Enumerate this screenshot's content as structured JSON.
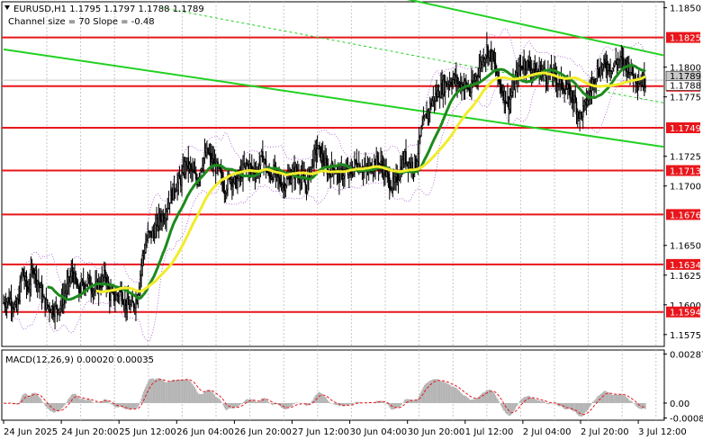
{
  "chart_data": {
    "type": "candlestick",
    "symbol_header": "EURUSD,H1  1.1795 1.1797 1.1788 1.1789",
    "channel_info": "Channel size = 70 Slope = -0.48",
    "price_axis": {
      "min": 1.1565,
      "max": 1.1855,
      "ticks": [
        "1.1850",
        "1.1800",
        "1.1775",
        "1.1725",
        "1.1700",
        "1.1650",
        "1.1625",
        "1.1600",
        "1.1575"
      ],
      "tick_values": [
        1.185,
        1.18,
        1.1775,
        1.1725,
        1.17,
        1.165,
        1.1625,
        1.16,
        1.1575
      ]
    },
    "time_axis_labels": [
      "24 Jun 2025",
      "24 Jun 20:00",
      "25 Jun 12:00",
      "26 Jun 04:00",
      "26 Jun 20:00",
      "27 Jun 12:00",
      "30 Jun 04:00",
      "30 Jun 20:00",
      "1 Jul 12:00",
      "2 Jul 04:00",
      "2 Jul 20:00",
      "3 Jul 12:00"
    ],
    "levels": [
      {
        "label": "1.1825",
        "value": 1.1825
      },
      {
        "label": "1.1784",
        "value": 1.1784
      },
      {
        "label": "1.1749",
        "value": 1.1749
      },
      {
        "label": "1.1713",
        "value": 1.1713
      },
      {
        "label": "1.1676",
        "value": 1.1676
      },
      {
        "label": "1.1634",
        "value": 1.1634
      },
      {
        "label": "1.1594",
        "value": 1.1594
      }
    ],
    "current_price_labels": [
      {
        "label": "1.1789",
        "value": 1.1789
      },
      {
        "label": "1.1788",
        "value": 1.1788
      }
    ],
    "close_path": [
      [
        0,
        1.1602
      ],
      [
        6,
        1.1605
      ],
      [
        12,
        1.1595
      ],
      [
        17,
        1.1628
      ],
      [
        22,
        1.1612
      ],
      [
        27,
        1.1632
      ],
      [
        32,
        1.1618
      ],
      [
        37,
        1.1602
      ],
      [
        42,
        1.1598
      ],
      [
        47,
        1.1596
      ],
      [
        52,
        1.16
      ],
      [
        58,
        1.1615
      ],
      [
        63,
        1.1628
      ],
      [
        68,
        1.161
      ],
      [
        73,
        1.1618
      ],
      [
        78,
        1.162
      ],
      [
        83,
        1.1612
      ],
      [
        88,
        1.1618
      ],
      [
        93,
        1.1625
      ],
      [
        97,
        1.1608
      ],
      [
        102,
        1.1606
      ],
      [
        107,
        1.1612
      ],
      [
        112,
        1.16
      ],
      [
        117,
        1.1598
      ],
      [
        122,
        1.1606
      ],
      [
        127,
        1.164
      ],
      [
        132,
        1.1658
      ],
      [
        137,
        1.166
      ],
      [
        142,
        1.1672
      ],
      [
        147,
        1.1676
      ],
      [
        152,
        1.169
      ],
      [
        157,
        1.17
      ],
      [
        162,
        1.1705
      ],
      [
        167,
        1.172
      ],
      [
        172,
        1.1712
      ],
      [
        177,
        1.1705
      ],
      [
        182,
        1.1722
      ],
      [
        187,
        1.1728
      ],
      [
        192,
        1.1718
      ],
      [
        197,
        1.1712
      ],
      [
        202,
        1.1698
      ],
      [
        207,
        1.1708
      ],
      [
        212,
        1.1702
      ],
      [
        217,
        1.171
      ],
      [
        222,
        1.1718
      ],
      [
        227,
        1.1714
      ],
      [
        232,
        1.1712
      ],
      [
        237,
        1.1726
      ],
      [
        242,
        1.1708
      ],
      [
        247,
        1.1712
      ],
      [
        252,
        1.1704
      ],
      [
        257,
        1.1702
      ],
      [
        262,
        1.1708
      ],
      [
        267,
        1.1712
      ],
      [
        272,
        1.1708
      ],
      [
        277,
        1.17
      ],
      [
        282,
        1.172
      ],
      [
        287,
        1.1732
      ],
      [
        292,
        1.1722
      ],
      [
        297,
        1.1712
      ],
      [
        302,
        1.1716
      ],
      [
        307,
        1.1708
      ],
      [
        312,
        1.1712
      ],
      [
        317,
        1.171
      ],
      [
        322,
        1.172
      ],
      [
        327,
        1.1716
      ],
      [
        332,
        1.1712
      ],
      [
        337,
        1.1718
      ],
      [
        342,
        1.172
      ],
      [
        347,
        1.1716
      ],
      [
        352,
        1.1704
      ],
      [
        357,
        1.17
      ],
      [
        362,
        1.1712
      ],
      [
        367,
        1.1724
      ],
      [
        372,
        1.1718
      ],
      [
        377,
        1.172
      ],
      [
        382,
        1.1745
      ],
      [
        387,
        1.176
      ],
      [
        392,
        1.1772
      ],
      [
        397,
        1.1778
      ],
      [
        402,
        1.1784
      ],
      [
        407,
        1.1788
      ],
      [
        412,
        1.179
      ],
      [
        417,
        1.1786
      ],
      [
        422,
        1.1785
      ],
      [
        427,
        1.178
      ],
      [
        432,
        1.1792
      ],
      [
        437,
        1.1805
      ],
      [
        442,
        1.1815
      ],
      [
        447,
        1.1808
      ],
      [
        452,
        1.179
      ],
      [
        457,
        1.1778
      ],
      [
        462,
        1.177
      ],
      [
        467,
        1.1785
      ],
      [
        472,
        1.18
      ],
      [
        477,
        1.1804
      ],
      [
        482,
        1.18
      ],
      [
        487,
        1.1796
      ],
      [
        492,
        1.1798
      ],
      [
        497,
        1.1792
      ],
      [
        502,
        1.1795
      ],
      [
        507,
        1.1788
      ],
      [
        512,
        1.1784
      ],
      [
        517,
        1.178
      ],
      [
        522,
        1.1772
      ],
      [
        527,
        1.1758
      ],
      [
        532,
        1.1768
      ],
      [
        537,
        1.1782
      ],
      [
        542,
        1.1795
      ],
      [
        547,
        1.18
      ],
      [
        552,
        1.1802
      ],
      [
        557,
        1.18
      ],
      [
        562,
        1.1806
      ],
      [
        567,
        1.1804
      ],
      [
        572,
        1.18
      ],
      [
        577,
        1.1792
      ],
      [
        582,
        1.1788
      ],
      [
        587,
        1.1789
      ]
    ]
  },
  "macd": {
    "label": "MACD(12,26,9) 0.00020 0.00035",
    "axis_labels": [
      "0.00287",
      "0.00",
      "-0.00087"
    ],
    "axis_values": [
      0.00287,
      0.0,
      -0.00087
    ],
    "min": -0.001,
    "max": 0.0031
  }
}
